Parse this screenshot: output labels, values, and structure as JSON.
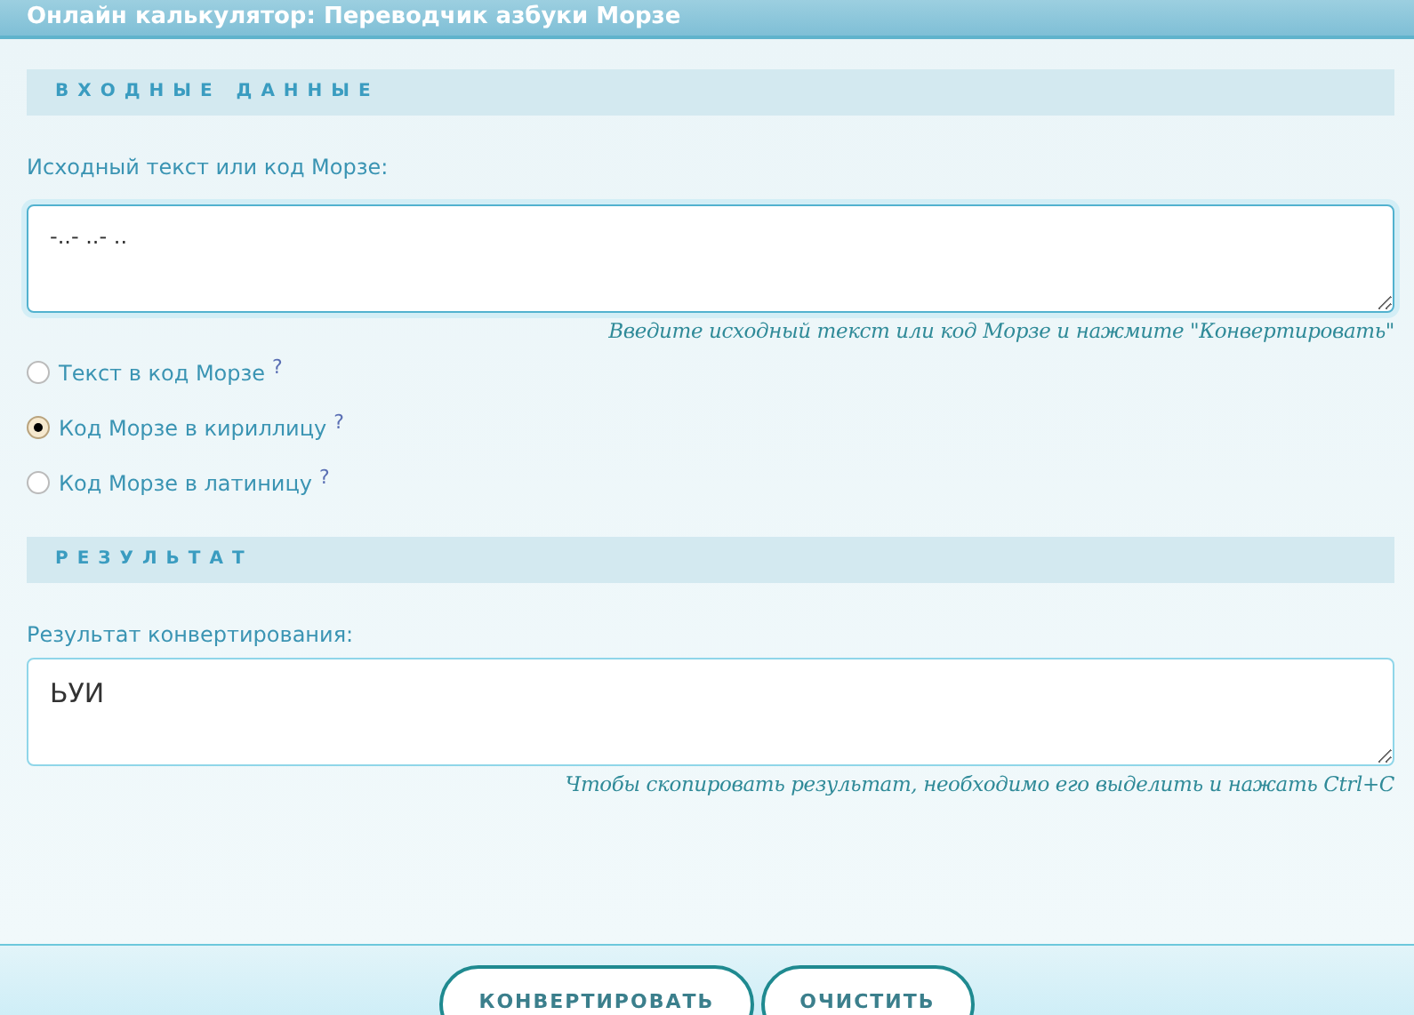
{
  "header": {
    "title": "Онлайн калькулятор: Переводчик азбуки Морзе"
  },
  "input_section": {
    "heading": "ВХОДНЫЕ ДАННЫЕ",
    "label": "Исходный текст или код Морзе:",
    "value": "-..- ..- ..",
    "hint": "Введите исходный текст или код Морзе и нажмите \"Конвертировать\""
  },
  "modes": [
    {
      "label": "Текст в код Морзе",
      "help": "?",
      "selected": false
    },
    {
      "label": "Код Морзе в кириллицу",
      "help": "?",
      "selected": true
    },
    {
      "label": "Код Морзе в латиницу",
      "help": "?",
      "selected": false
    }
  ],
  "result_section": {
    "heading": "РЕЗУЛЬТАТ",
    "label": "Результат конвертирования:",
    "value": "ЬУИ",
    "hint": "Чтобы скопировать результат, необходимо его выделить и нажать Ctrl+C"
  },
  "buttons": [
    {
      "label": "КОНВЕРТИРОВАТЬ"
    },
    {
      "label": "ОЧИСТИТЬ"
    }
  ]
}
